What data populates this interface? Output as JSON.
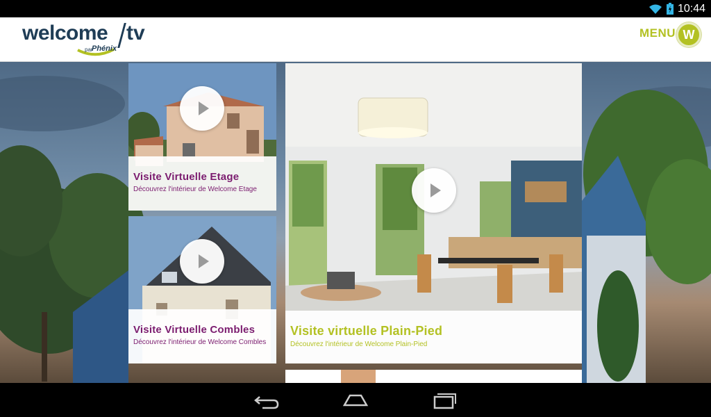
{
  "status_bar": {
    "time": "10:44"
  },
  "header": {
    "logo_welcome": "welcome",
    "logo_tv": "tv",
    "logo_par": "par",
    "logo_phenix": "Phénix",
    "menu_label": "MENU",
    "avatar_letter": "W"
  },
  "cards": [
    {
      "title": "Visite Virtuelle Etage",
      "subtitle": "Découvrez l'intérieur de Welcome Etage"
    },
    {
      "title": "Visite Virtuelle Combles",
      "subtitle": "Découvrez l'intérieur de Welcome Combles"
    },
    {
      "title": "Visite virtuelle Plain-Pied",
      "subtitle": "Découvrez l'intérieur de Welcome Plain-Pied"
    }
  ],
  "colors": {
    "brand_navy": "#1f3d56",
    "accent_lime": "#b3c123",
    "caption_purple": "#7b1c6f"
  }
}
